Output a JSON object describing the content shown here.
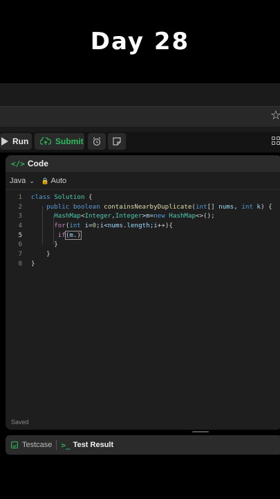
{
  "overlay_title": "Day  28",
  "toolbar": {
    "run_label": "Run",
    "submit_label": "Submit"
  },
  "panel": {
    "title": "Code",
    "language": "Java",
    "mode": "Auto",
    "status": "Saved"
  },
  "editor": {
    "line_numbers": [
      "1",
      "2",
      "3",
      "4",
      "5",
      "6",
      "7",
      "8"
    ]
  },
  "bottom_tabs": {
    "testcase": "Testcase",
    "test_result": "Test Result"
  },
  "colors": {
    "accent_green": "#2cbb5d",
    "panel_bg": "#1e1e1e"
  },
  "icons": [
    "play-icon",
    "cloud-upload-icon",
    "alarm-clock-icon",
    "note-icon",
    "grid-layout-icon",
    "code-icon",
    "chevron-down-icon",
    "lock-icon",
    "star-icon",
    "checkbox-icon",
    "terminal-icon"
  ]
}
